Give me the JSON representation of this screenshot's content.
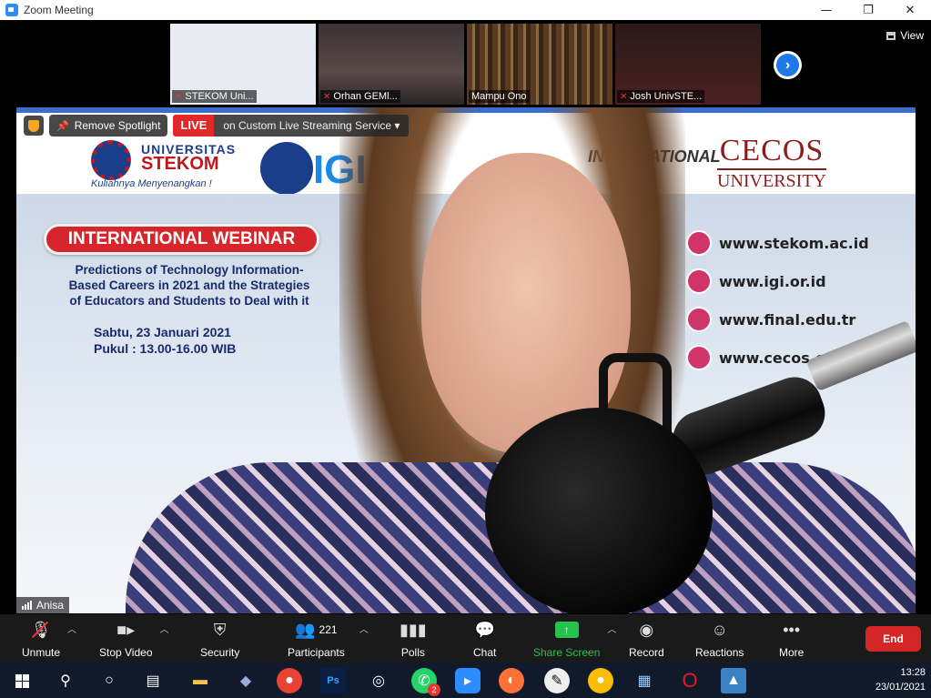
{
  "window": {
    "title": "Zoom Meeting",
    "min": "—",
    "max": "❐",
    "close": "✕"
  },
  "thumbnails": [
    {
      "name": "STEKOM Uni..."
    },
    {
      "name": "Orhan GEMl..."
    },
    {
      "name": "Mampu Ono"
    },
    {
      "name": "Josh UnivSTE..."
    }
  ],
  "view_label": "View",
  "next_arrow": "›",
  "overlay": {
    "remove_spotlight": "Remove Spotlight",
    "live": "LIVE",
    "live_service": "on Custom Live Streaming Service"
  },
  "banner": {
    "univ": "UNIVERSITAS",
    "stekom": "STEKOM",
    "tagline": "Kuliahnya Menyenangkan !",
    "igi": "IGI",
    "international": "INTERNATIONAL",
    "cecos1": "CECOS",
    "cecos2": "UNIVERSITY",
    "webinar": "INTERNATIONAL WEBINAR",
    "pred1": "Predictions of Technology Information-",
    "pred2": "Based Careers in 2021 and the Strategies",
    "pred3": "of Educators and Students to Deal with it",
    "date": "Sabtu, 23 Januari 2021",
    "time": "Pukul : 13.00-16.00 WIB",
    "urls": [
      "www.stekom.ac.id",
      "www.igi.or.id",
      "www.final.edu.tr",
      "www.cecos.edu"
    ]
  },
  "speaker_name": "Anisa",
  "toolbar": {
    "unmute": "Unmute",
    "stop_video": "Stop Video",
    "security": "Security",
    "participants": "Participants",
    "participants_count": "221",
    "polls": "Polls",
    "chat": "Chat",
    "share_screen": "Share Screen",
    "record": "Record",
    "reactions": "Reactions",
    "more": "More",
    "end": "End"
  },
  "taskbar": {
    "time": "13:28",
    "date": "23/01/2021",
    "whatsapp_badge": "2"
  },
  "colors": {
    "accent": "#2d8cff",
    "end": "#d52626",
    "live": "#e02828",
    "share": "#26c24f"
  }
}
